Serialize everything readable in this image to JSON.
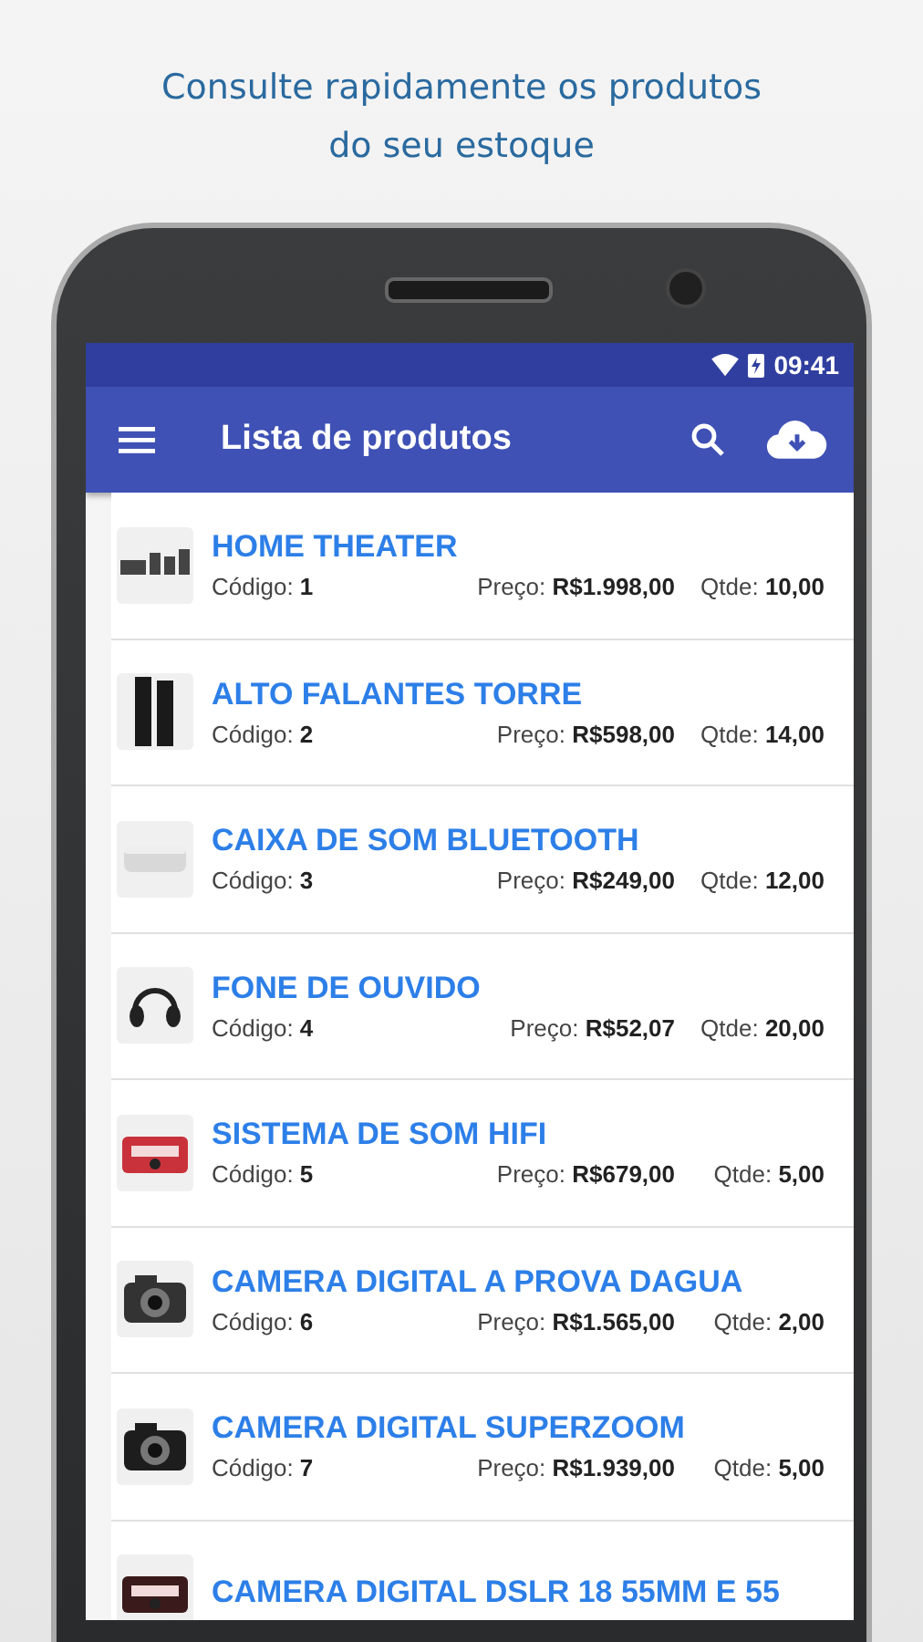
{
  "caption": "Consulte rapidamente os produtos do seu estoque",
  "status_bar": {
    "time": "09:41"
  },
  "toolbar": {
    "title": "Lista de produtos"
  },
  "products": [
    {
      "title": "HOME THEATER",
      "code_label": "Código:",
      "code": "1",
      "price_label": "Preço:",
      "price": "R$1.998,00",
      "qty_label": "Qtde:",
      "qty": "10,00"
    },
    {
      "title": "ALTO FALANTES TORRE",
      "code_label": "Código:",
      "code": "2",
      "price_label": "Preço:",
      "price": "R$598,00",
      "qty_label": "Qtde:",
      "qty": "14,00"
    },
    {
      "title": "CAIXA DE SOM BLUETOOTH",
      "code_label": "Código:",
      "code": "3",
      "price_label": "Preço:",
      "price": "R$249,00",
      "qty_label": "Qtde:",
      "qty": "12,00"
    },
    {
      "title": "FONE DE OUVIDO",
      "code_label": "Código:",
      "code": "4",
      "price_label": "Preço:",
      "price": "R$52,07",
      "qty_label": "Qtde:",
      "qty": "20,00"
    },
    {
      "title": "SISTEMA DE SOM HIFI",
      "code_label": "Código:",
      "code": "5",
      "price_label": "Preço:",
      "price": "R$679,00",
      "qty_label": "Qtde:",
      "qty": "5,00"
    },
    {
      "title": "CAMERA DIGITAL A PROVA DAGUA",
      "code_label": "Código:",
      "code": "6",
      "price_label": "Preço:",
      "price": "R$1.565,00",
      "qty_label": "Qtde:",
      "qty": "2,00"
    },
    {
      "title": "CAMERA DIGITAL SUPERZOOM",
      "code_label": "Código:",
      "code": "7",
      "price_label": "Preço:",
      "price": "R$1.939,00",
      "qty_label": "Qtde:",
      "qty": "5,00"
    },
    {
      "title": "CAMERA DIGITAL DSLR 18 55MM E 55"
    }
  ]
}
